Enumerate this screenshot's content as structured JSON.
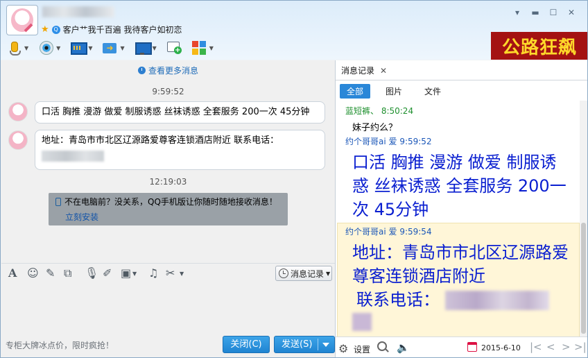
{
  "header": {
    "signature": "客户艹我千百遍  我待客户如初恋",
    "banner": "公路狂飙"
  },
  "window_controls": {
    "menu": "▾",
    "minimize": "▬",
    "maximize": "☐",
    "close": "✕"
  },
  "chat": {
    "more_messages": "查看更多消息",
    "messages": [
      {
        "time": "9:59:52",
        "text": "口活  胸推  漫游  做爱  制服诱惑  丝袜诱惑  全套服务  200一次  45分钟"
      },
      {
        "text": "地址：青岛市市北区辽源路爱尊客连锁酒店附近     联系电话："
      }
    ],
    "time2": "12:19:03",
    "notice_text": "不在电脑前？没关系，QQ手机版让你随时随地接收消息！",
    "notice_link": "立刻安装"
  },
  "input": {
    "history_button": "消息记录",
    "ad_text": "专柜大牌冰点价，限时疯抢！",
    "close_button": "关闭(C)",
    "send_button": "发送(S)"
  },
  "history": {
    "panel_tab": "消息记录",
    "close_icon": "✕",
    "filters": [
      "全部",
      "图片",
      "文件"
    ],
    "entries": [
      {
        "sender": "蓝短裤、 8:50:24",
        "text": "妹子约么？"
      },
      {
        "sender": "约个哥哥ai 爱 9:59:52",
        "text": "口活  胸推  漫游  做爱  制服诱惑  丝袜诱惑  全套服务  200一次  45分钟"
      },
      {
        "sender": "约个哥哥ai 爱 9:59:54",
        "line1": "地址：青岛市市北区辽源路爱尊客连锁酒店附近",
        "line2": "联系电话："
      }
    ],
    "settings_label": "设置",
    "date": "2015-6-10"
  },
  "colors": {
    "accent": "#2a87d8",
    "banner_bg": "#a41212",
    "banner_text": "#ffd92a",
    "history_big_text": "#0a1fd0",
    "sender_green": "#1d8f2d",
    "sender_blue": "#1a56b8"
  }
}
